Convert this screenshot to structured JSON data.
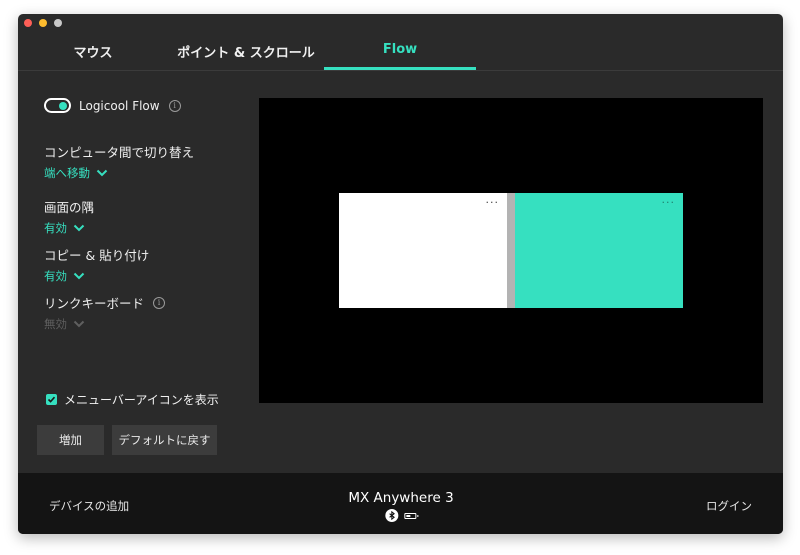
{
  "tabs": [
    {
      "label": "マウス"
    },
    {
      "label": "ポイント & スクロール"
    },
    {
      "label": "Flow"
    }
  ],
  "flow": {
    "toggle_label": "Logicool Flow",
    "toggle_on": true,
    "info_glyph": "i"
  },
  "settings": {
    "switch": {
      "label": "コンピュータ間で切り替え",
      "value": "端へ移動"
    },
    "corner": {
      "label": "画面の隅",
      "value": "有効"
    },
    "copy": {
      "label": "コピー & 貼り付け",
      "value": "有効"
    },
    "link": {
      "label": "リンクキーボード",
      "value": "無効"
    }
  },
  "menubar": {
    "label": "メニューバーアイコンを表示",
    "checked": true
  },
  "buttons": {
    "add": "増加",
    "reset": "デフォルトに戻す"
  },
  "preview": {
    "dots": "···"
  },
  "footer": {
    "add_device": "デバイスの追加",
    "device_name": "MX Anywhere 3",
    "login": "ログイン",
    "battery_level": 0.5
  },
  "colors": {
    "accent": "#36e0c0",
    "background": "#2a2a2a",
    "footer": "#141414"
  }
}
